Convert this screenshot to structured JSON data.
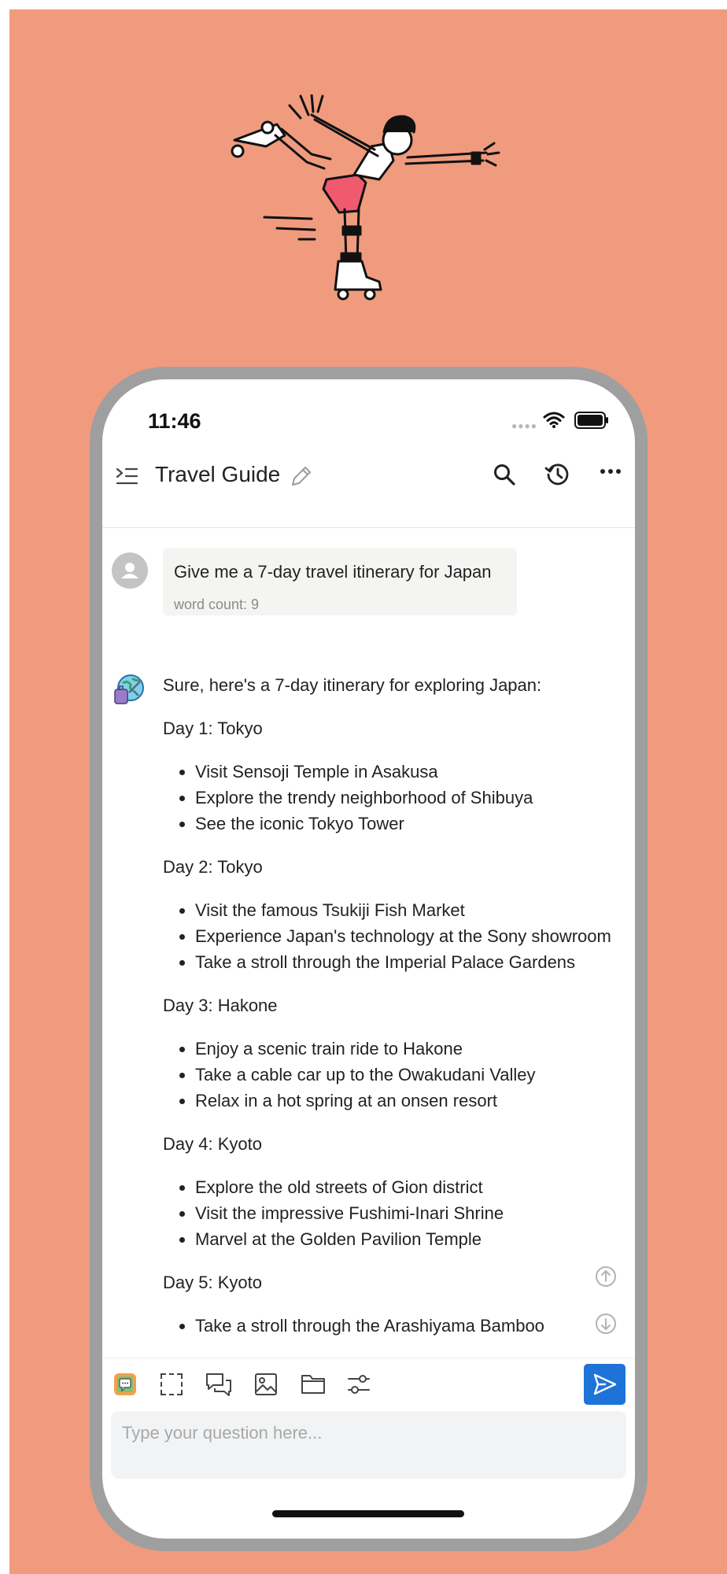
{
  "status_bar": {
    "time": "11:46"
  },
  "nav": {
    "title": "Travel Guide"
  },
  "user_message": {
    "text": "Give me a 7-day travel itinerary for Japan",
    "word_count": "word count: 9"
  },
  "answer": {
    "intro": "Sure, here's a 7-day itinerary for exploring Japan:",
    "days": [
      {
        "heading": "Day 1: Tokyo",
        "items": [
          "Visit Sensoji Temple in Asakusa",
          "Explore the trendy neighborhood of Shibuya",
          "See the iconic Tokyo Tower"
        ]
      },
      {
        "heading": "Day 2: Tokyo",
        "items": [
          "Visit the famous Tsukiji Fish Market",
          "Experience Japan's technology at the Sony showroom",
          "Take a stroll through the Imperial Palace Gardens"
        ]
      },
      {
        "heading": "Day 3: Hakone",
        "items": [
          "Enjoy a scenic train ride to Hakone",
          "Take a cable car up to the Owakudani Valley",
          "Relax in a hot spring at an onsen resort"
        ]
      },
      {
        "heading": "Day 4: Kyoto",
        "items": [
          "Explore the old streets of Gion district",
          "Visit the impressive Fushimi-Inari Shrine",
          "Marvel at the Golden Pavilion Temple"
        ]
      },
      {
        "heading": "Day 5: Kyoto",
        "items": [
          "Take a stroll through the Arashiyama Bamboo"
        ]
      }
    ]
  },
  "input": {
    "placeholder": "Type your question here..."
  },
  "colors": {
    "background": "#F09B7E",
    "accent": "#1E73D8",
    "frame": "#9F9F9F"
  },
  "icons": {
    "toolbar": [
      "chat-app-icon",
      "screenshot-select-icon",
      "chat-bubbles-icon",
      "image-icon",
      "folder-icon",
      "settings-sliders-icon"
    ],
    "nav": [
      "menu-icon",
      "edit-pencil-icon",
      "search-icon",
      "history-icon",
      "more-icon"
    ]
  }
}
